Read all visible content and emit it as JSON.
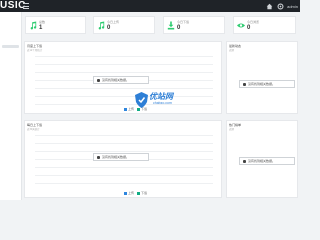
{
  "header": {
    "brand": "USIC",
    "user": "admin"
  },
  "stats": [
    {
      "label": "总数",
      "value": "1",
      "icon": "music-note-icon",
      "color": "#2ecc71"
    },
    {
      "label": "今日上传",
      "value": "0",
      "icon": "music-note-icon",
      "color": "#2ecc71"
    },
    {
      "label": "今日下载",
      "value": "0",
      "icon": "download-icon",
      "color": "#2ecc71"
    },
    {
      "label": "今日浏览",
      "value": "0",
      "icon": "eye-icon",
      "color": "#2ecc71"
    }
  ],
  "panels": {
    "chart1": {
      "title": "月度上下载",
      "subtitle": "近12个月统计",
      "nodata": "没有找到相关数据。"
    },
    "side1": {
      "title": "最新动态",
      "subtitle": "近期",
      "nodata": "没有找到相关数据。"
    },
    "chart2": {
      "title": "每日上下载",
      "subtitle": "近30天统计",
      "nodata": "没有找到相关数据。"
    },
    "side2": {
      "title": "热门榜单",
      "subtitle": "近期",
      "nodata": "没有找到相关数据。"
    }
  },
  "legend": {
    "upload": "上传",
    "download": "下载",
    "upload_color": "#2e86de",
    "download_color": "#10ac84"
  },
  "watermark": {
    "title": "优站网",
    "sub": "chabzo.com"
  }
}
